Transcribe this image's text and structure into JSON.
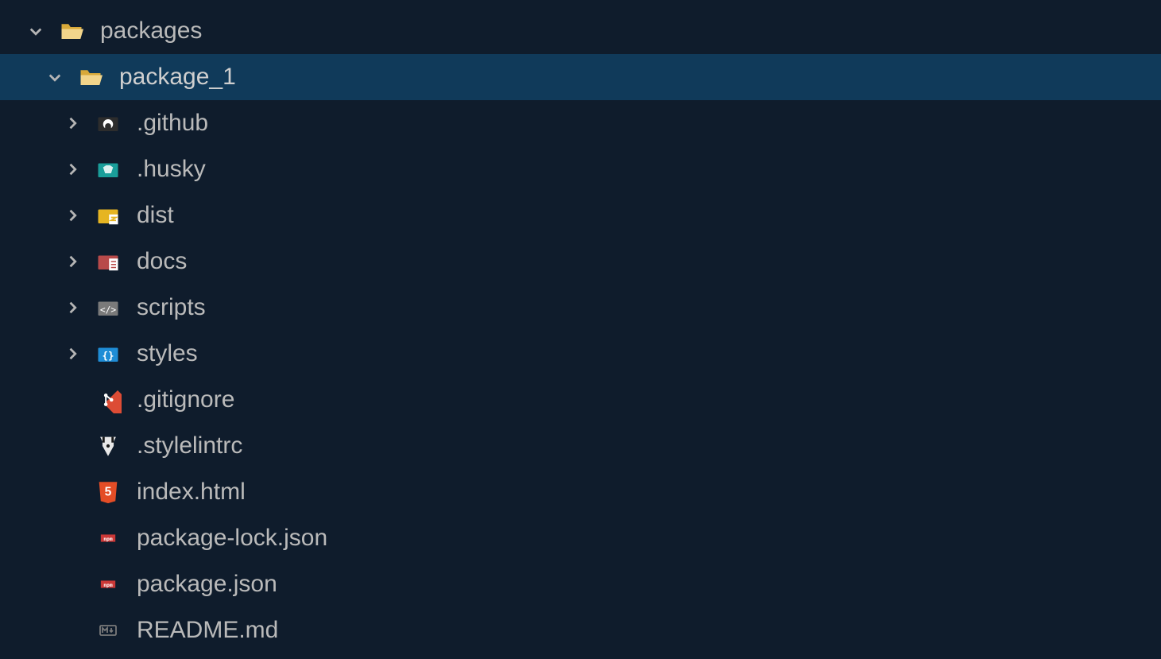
{
  "tree": {
    "packages": {
      "label": "packages",
      "expanded": true,
      "package_1": {
        "label": "package_1",
        "expanded": true,
        "selected": true,
        "children": {
          "github": {
            "label": ".github",
            "type": "folder",
            "expanded": false
          },
          "husky": {
            "label": ".husky",
            "type": "folder",
            "expanded": false
          },
          "dist": {
            "label": "dist",
            "type": "folder",
            "expanded": false
          },
          "docs": {
            "label": "docs",
            "type": "folder",
            "expanded": false
          },
          "scripts": {
            "label": "scripts",
            "type": "folder",
            "expanded": false
          },
          "styles": {
            "label": "styles",
            "type": "folder",
            "expanded": false
          },
          "gitignore": {
            "label": ".gitignore",
            "type": "file"
          },
          "stylelintrc": {
            "label": ".stylelintrc",
            "type": "file"
          },
          "indexhtml": {
            "label": "index.html",
            "type": "file"
          },
          "pkglock": {
            "label": "package-lock.json",
            "type": "file"
          },
          "pkgjson": {
            "label": "package.json",
            "type": "file"
          },
          "readme": {
            "label": "README.md",
            "type": "file"
          }
        }
      }
    }
  }
}
